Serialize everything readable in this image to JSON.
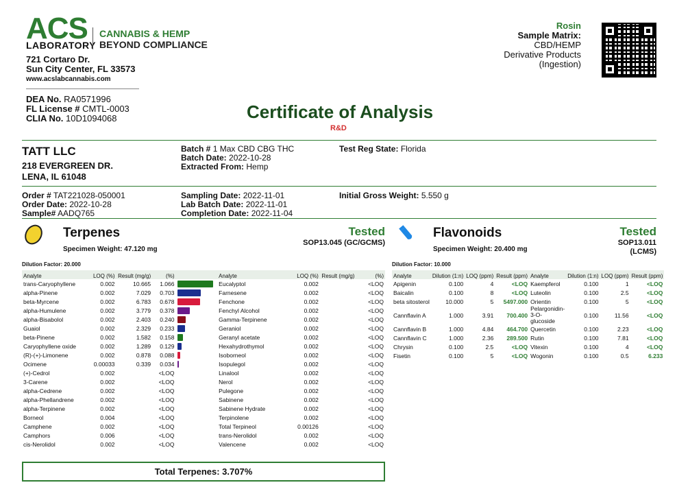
{
  "lab": {
    "logo_main": "ACS",
    "logo_sub": "LABORATORY",
    "tagline1": "CANNABIS & HEMP",
    "tagline2": "BEYOND COMPLIANCE",
    "addr1": "721 Cortaro Dr.",
    "addr2": "Sun City Center, FL 33573",
    "website": "www.acslabcannabis.com",
    "dea_label": "DEA No.",
    "dea": "RA0571996",
    "fl_label": "FL License #",
    "fl": "CMTL-0003",
    "clia_label": "CLIA No.",
    "clia": "10D1094068"
  },
  "doc": {
    "title": "Certificate of Analysis",
    "subtitle": "R&D"
  },
  "matrix": {
    "product": "Rosin",
    "label": "Sample Matrix:",
    "line1": "CBD/HEMP",
    "line2": "Derivative Products",
    "line3": "(Ingestion)"
  },
  "client": {
    "name": "TATT LLC",
    "street": "218 EVERGREEN DR.",
    "city": "LENA, IL 61048"
  },
  "batch": {
    "batch_label": "Batch #",
    "batch": "1 Max CBD CBG THC",
    "batch_date_label": "Batch Date:",
    "batch_date": "2022-10-28",
    "extracted_label": "Extracted From:",
    "extracted": "Hemp",
    "state_label": "Test Reg State:",
    "state": "Florida"
  },
  "order": {
    "order_label": "Order #",
    "order": "TAT221028-050001",
    "order_date_label": "Order Date:",
    "order_date": "2022-10-28",
    "sample_label": "Sample#",
    "sample": "AADQ765",
    "sampling_label": "Sampling Date:",
    "sampling": "2022-11-01",
    "labbatch_label": "Lab Batch Date:",
    "labbatch": "2022-11-01",
    "completion_label": "Completion Date:",
    "completion": "2022-11-04",
    "gross_label": "Initial Gross Weight:",
    "gross": "5.550 g"
  },
  "terpenes": {
    "title": "Terpenes",
    "status": "Tested",
    "method": "SOP13.045 (GC/GCMS)",
    "weight": "Specimen Weight: 47.120 mg",
    "dilution": "Dilution Factor: 20.000",
    "headers": [
      "Analyte",
      "LOQ (%)",
      "Result (mg/g)",
      "(%)",
      "Analyte",
      "LOQ (%)",
      "Result (mg/g)",
      "(%)"
    ],
    "left_rows": [
      {
        "a": "trans-Caryophyllene",
        "loq": "0.002",
        "mg": "10.665",
        "pct": "1.066",
        "bar": 1.066,
        "color": "#1e7a1e"
      },
      {
        "a": "alpha-Pinene",
        "loq": "0.002",
        "mg": "7.029",
        "pct": "0.703",
        "bar": 0.703,
        "color": "#1a2e8f"
      },
      {
        "a": "beta-Myrcene",
        "loq": "0.002",
        "mg": "6.783",
        "pct": "0.678",
        "bar": 0.678,
        "color": "#d81b3c"
      },
      {
        "a": "alpha-Humulene",
        "loq": "0.002",
        "mg": "3.779",
        "pct": "0.378",
        "bar": 0.378,
        "color": "#6a1b8a"
      },
      {
        "a": "alpha-Bisabolol",
        "loq": "0.002",
        "mg": "2.403",
        "pct": "0.240",
        "bar": 0.24,
        "color": "#8b0f1a"
      },
      {
        "a": "Guaiol",
        "loq": "0.002",
        "mg": "2.329",
        "pct": "0.233",
        "bar": 0.233,
        "color": "#1a2e8f"
      },
      {
        "a": "beta-Pinene",
        "loq": "0.002",
        "mg": "1.582",
        "pct": "0.158",
        "bar": 0.158,
        "color": "#1e7a1e"
      },
      {
        "a": "Caryophyllene oxide",
        "loq": "0.002",
        "mg": "1.289",
        "pct": "0.129",
        "bar": 0.129,
        "color": "#1a2e8f"
      },
      {
        "a": "(R)-(+)-Limonene",
        "loq": "0.002",
        "mg": "0.878",
        "pct": "0.088",
        "bar": 0.088,
        "color": "#d81b3c"
      },
      {
        "a": "Ocimene",
        "loq": "0.00033",
        "mg": "0.339",
        "pct": "0.034",
        "bar": 0.034,
        "color": "#6a1b8a"
      },
      {
        "a": "(+)-Cedrol",
        "loq": "0.002",
        "mg": "",
        "pct": "<LOQ"
      },
      {
        "a": "3-Carene",
        "loq": "0.002",
        "mg": "",
        "pct": "<LOQ"
      },
      {
        "a": "alpha-Cedrene",
        "loq": "0.002",
        "mg": "",
        "pct": "<LOQ"
      },
      {
        "a": "alpha-Phellandrene",
        "loq": "0.002",
        "mg": "",
        "pct": "<LOQ"
      },
      {
        "a": "alpha-Terpinene",
        "loq": "0.002",
        "mg": "",
        "pct": "<LOQ"
      },
      {
        "a": "Borneol",
        "loq": "0.004",
        "mg": "",
        "pct": "<LOQ"
      },
      {
        "a": "Camphene",
        "loq": "0.002",
        "mg": "",
        "pct": "<LOQ"
      },
      {
        "a": "Camphors",
        "loq": "0.006",
        "mg": "",
        "pct": "<LOQ"
      },
      {
        "a": "cis-Nerolidol",
        "loq": "0.002",
        "mg": "",
        "pct": "<LOQ"
      }
    ],
    "right_rows": [
      {
        "a": "Eucalyptol",
        "loq": "0.002",
        "mg": "",
        "pct": "<LOQ"
      },
      {
        "a": "Farnesene",
        "loq": "0.002",
        "mg": "",
        "pct": "<LOQ"
      },
      {
        "a": "Fenchone",
        "loq": "0.002",
        "mg": "",
        "pct": "<LOQ"
      },
      {
        "a": "Fenchyl Alcohol",
        "loq": "0.002",
        "mg": "",
        "pct": "<LOQ"
      },
      {
        "a": "Gamma-Terpinene",
        "loq": "0.002",
        "mg": "",
        "pct": "<LOQ"
      },
      {
        "a": "Geraniol",
        "loq": "0.002",
        "mg": "",
        "pct": "<LOQ"
      },
      {
        "a": "Geranyl acetate",
        "loq": "0.002",
        "mg": "",
        "pct": "<LOQ"
      },
      {
        "a": "Hexahydrothymol",
        "loq": "0.002",
        "mg": "",
        "pct": "<LOQ"
      },
      {
        "a": "Isoborneol",
        "loq": "0.002",
        "mg": "",
        "pct": "<LOQ"
      },
      {
        "a": "Isopulegol",
        "loq": "0.002",
        "mg": "",
        "pct": "<LOQ"
      },
      {
        "a": "Linalool",
        "loq": "0.002",
        "mg": "",
        "pct": "<LOQ"
      },
      {
        "a": "Nerol",
        "loq": "0.002",
        "mg": "",
        "pct": "<LOQ"
      },
      {
        "a": "Pulegone",
        "loq": "0.002",
        "mg": "",
        "pct": "<LOQ"
      },
      {
        "a": "Sabinene",
        "loq": "0.002",
        "mg": "",
        "pct": "<LOQ"
      },
      {
        "a": "Sabinene Hydrate",
        "loq": "0.002",
        "mg": "",
        "pct": "<LOQ"
      },
      {
        "a": "Terpinolene",
        "loq": "0.002",
        "mg": "",
        "pct": "<LOQ"
      },
      {
        "a": "Total Terpineol",
        "loq": "0.00126",
        "mg": "",
        "pct": "<LOQ"
      },
      {
        "a": "trans-Nerolidol",
        "loq": "0.002",
        "mg": "",
        "pct": "<LOQ"
      },
      {
        "a": "Valencene",
        "loq": "0.002",
        "mg": "",
        "pct": "<LOQ"
      }
    ],
    "total": "Total Terpenes: 3.707%"
  },
  "flavonoids": {
    "title": "Flavonoids",
    "status": "Tested",
    "method1": "SOP13.011",
    "method2": "(LCMS)",
    "weight": "Specimen Weight: 20.400 mg",
    "dilution": "Dilution Factor: 10.000",
    "headers": [
      "Analyte",
      "Dilution (1:n)",
      "LOQ (ppm)",
      "Result (ppm)",
      "Analyte",
      "Dilution (1:n)",
      "LOQ (ppm)",
      "Result (ppm)"
    ],
    "left_rows": [
      {
        "a": "Apigenin",
        "d": "0.100",
        "loq": "4",
        "r": "<LOQ"
      },
      {
        "a": "Baicalin",
        "d": "0.100",
        "loq": "8",
        "r": "<LOQ"
      },
      {
        "a": "beta sitosterol",
        "d": "10.000",
        "loq": "5",
        "r": "5497.000"
      },
      {
        "a": "Cannflavin A",
        "d": "1.000",
        "loq": "3.91",
        "r": "700.400"
      },
      {
        "a": "Cannflavin B",
        "d": "1.000",
        "loq": "4.84",
        "r": "464.700"
      },
      {
        "a": "Cannflavin C",
        "d": "1.000",
        "loq": "2.36",
        "r": "289.500"
      },
      {
        "a": "Chrysin",
        "d": "0.100",
        "loq": "2.5",
        "r": "<LOQ"
      },
      {
        "a": "Fisetin",
        "d": "0.100",
        "loq": "5",
        "r": "<LOQ"
      }
    ],
    "right_rows": [
      {
        "a": "Kaempferol",
        "d": "0.100",
        "loq": "1",
        "r": "<LOQ"
      },
      {
        "a": "Luteolin",
        "d": "0.100",
        "loq": "2.5",
        "r": "<LOQ"
      },
      {
        "a": "Orientin",
        "d": "0.100",
        "loq": "5",
        "r": "<LOQ"
      },
      {
        "a": "Pelargonidin-3-O-glucoside",
        "d": "0.100",
        "loq": "11.56",
        "r": "<LOQ"
      },
      {
        "a": "Quercetin",
        "d": "0.100",
        "loq": "2.23",
        "r": "<LOQ"
      },
      {
        "a": "Rutin",
        "d": "0.100",
        "loq": "7.81",
        "r": "<LOQ"
      },
      {
        "a": "Vitexin",
        "d": "0.100",
        "loq": "4",
        "r": "<LOQ"
      },
      {
        "a": "Wogonin",
        "d": "0.100",
        "loq": "0.5",
        "r": "6.233"
      }
    ]
  }
}
